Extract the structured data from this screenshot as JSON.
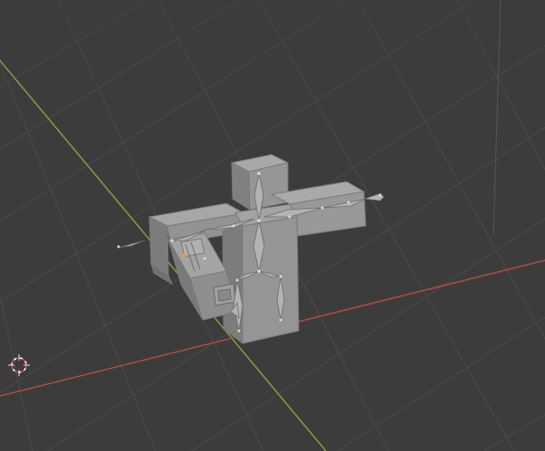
{
  "viewport": {
    "mode": "3d-viewport",
    "background_color": "#3c3c3c",
    "grid_color": "#4a4a4a",
    "x_axis_color": "#b34a4a",
    "y_axis_color": "#7ea23a",
    "mesh_color": "#9b9b9b",
    "bone_color": "#a6a6a6",
    "active_vertex_color": "#f0a030"
  },
  "objects": {
    "mesh_name": "character-mesh",
    "armature_name": "armature",
    "cursor_name": "3d-cursor-icon"
  }
}
